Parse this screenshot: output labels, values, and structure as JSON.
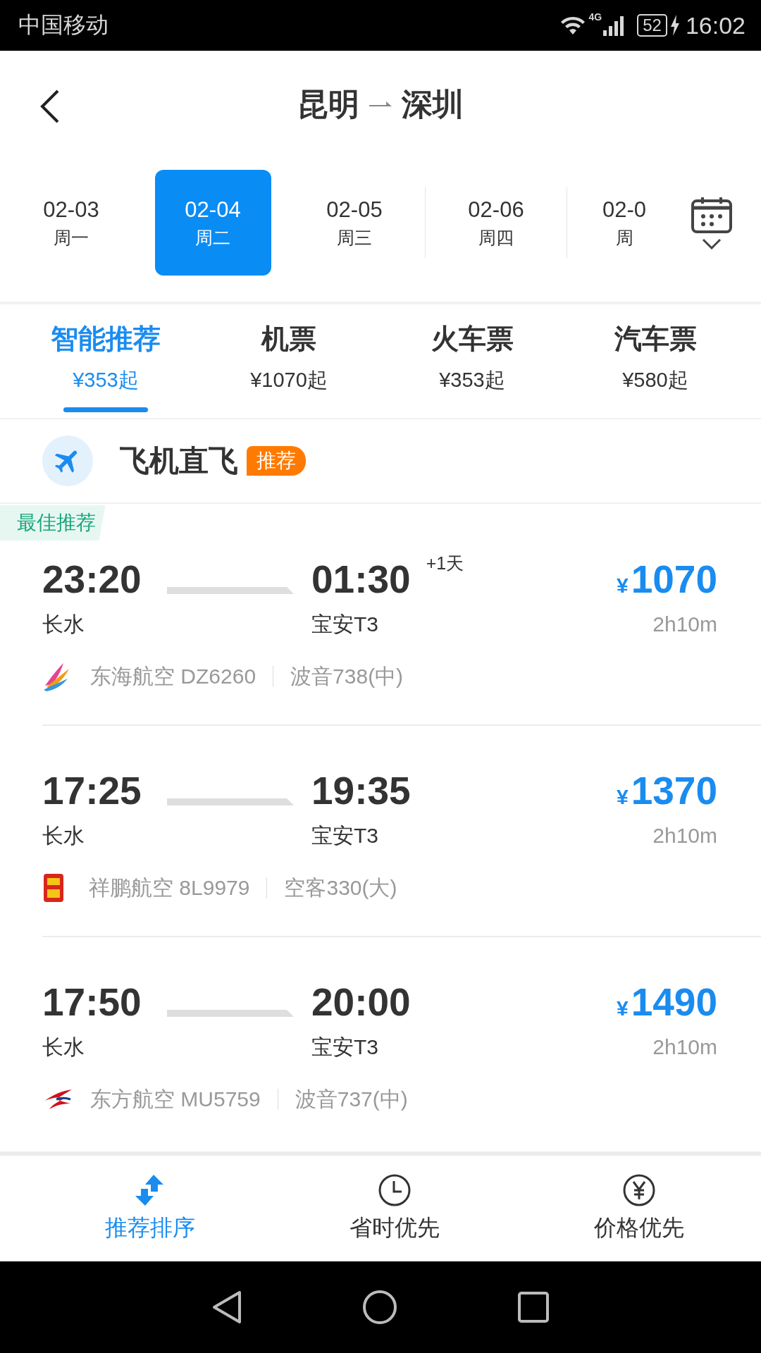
{
  "status_bar": {
    "carrier": "中国移动",
    "network": "4G",
    "battery": "52",
    "time": "16:02"
  },
  "header": {
    "from": "昆明",
    "to": "深圳"
  },
  "dates": [
    {
      "date": "02-03",
      "weekday": "周一",
      "selected": false
    },
    {
      "date": "02-04",
      "weekday": "周二",
      "selected": true
    },
    {
      "date": "02-05",
      "weekday": "周三",
      "selected": false
    },
    {
      "date": "02-06",
      "weekday": "周四",
      "selected": false
    },
    {
      "date": "02-0",
      "weekday": "周",
      "selected": false
    }
  ],
  "tabs": [
    {
      "label": "智能推荐",
      "price": "¥353起",
      "selected": true
    },
    {
      "label": "机票",
      "price": "¥1070起",
      "selected": false
    },
    {
      "label": "火车票",
      "price": "¥353起",
      "selected": false
    },
    {
      "label": "汽车票",
      "price": "¥580起",
      "selected": false
    }
  ],
  "section": {
    "title": "飞机直飞",
    "badge": "推荐"
  },
  "flights": [
    {
      "tag": "最佳推荐",
      "depart_time": "23:20",
      "depart_airport": "长水",
      "arrive_time": "01:30",
      "day_offset": "+1天",
      "arrive_airport": "宝安T3",
      "currency": "¥",
      "price": "1070",
      "duration": "2h10m",
      "airline": "东海航空 DZ6260",
      "aircraft": "波音738(中)"
    },
    {
      "depart_time": "17:25",
      "depart_airport": "长水",
      "arrive_time": "19:35",
      "arrive_airport": "宝安T3",
      "currency": "¥",
      "price": "1370",
      "duration": "2h10m",
      "airline": "祥鹏航空 8L9979",
      "aircraft": "空客330(大)"
    },
    {
      "depart_time": "17:50",
      "depart_airport": "长水",
      "arrive_time": "20:00",
      "arrive_airport": "宝安T3",
      "currency": "¥",
      "price": "1490",
      "duration": "2h10m",
      "airline": "东方航空 MU5759",
      "aircraft": "波音737(中)"
    }
  ],
  "sort_options": [
    {
      "label": "推荐排序",
      "selected": true
    },
    {
      "label": "省时优先",
      "selected": false
    },
    {
      "label": "价格优先",
      "selected": false
    }
  ]
}
